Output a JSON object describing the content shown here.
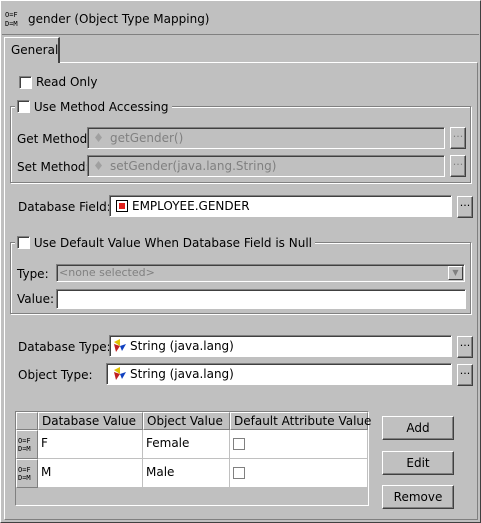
{
  "window": {
    "title": "gender (Object Type Mapping)"
  },
  "tabs": [
    {
      "label": "General",
      "selected": true
    }
  ],
  "read_only": {
    "label": "Read Only",
    "checked": false
  },
  "method_accessing": {
    "label": "Use Method Accessing",
    "checked": false,
    "get_label": "Get Method:",
    "get_value": "getGender()",
    "set_label": "Set Method:",
    "set_value": "setGender(java.lang.String)",
    "browse": "..."
  },
  "database_field": {
    "label": "Database Field:",
    "value": "EMPLOYEE.GENDER",
    "browse": "..."
  },
  "default_value": {
    "label": "Use Default Value When Database Field is Null",
    "checked": false,
    "type_label": "Type:",
    "type_value": "<none selected>",
    "value_label": "Value:",
    "value": ""
  },
  "database_type": {
    "label": "Database Type:",
    "value": "String (java.lang)",
    "browse": "..."
  },
  "object_type": {
    "label": "Object Type:",
    "value": "String (java.lang)",
    "browse": "..."
  },
  "table": {
    "columns": [
      "Database Value",
      "Object Value",
      "Default Attribute Value"
    ],
    "rows": [
      {
        "database_value": "F",
        "object_value": "Female",
        "default": false
      },
      {
        "database_value": "M",
        "object_value": "Male",
        "default": false
      }
    ]
  },
  "buttons": {
    "add": "Add",
    "edit": "Edit",
    "remove": "Remove"
  },
  "colors": {
    "background": "#c0c0c0",
    "db_field_icon": "#e0201c",
    "disabled_text": "#808080"
  }
}
